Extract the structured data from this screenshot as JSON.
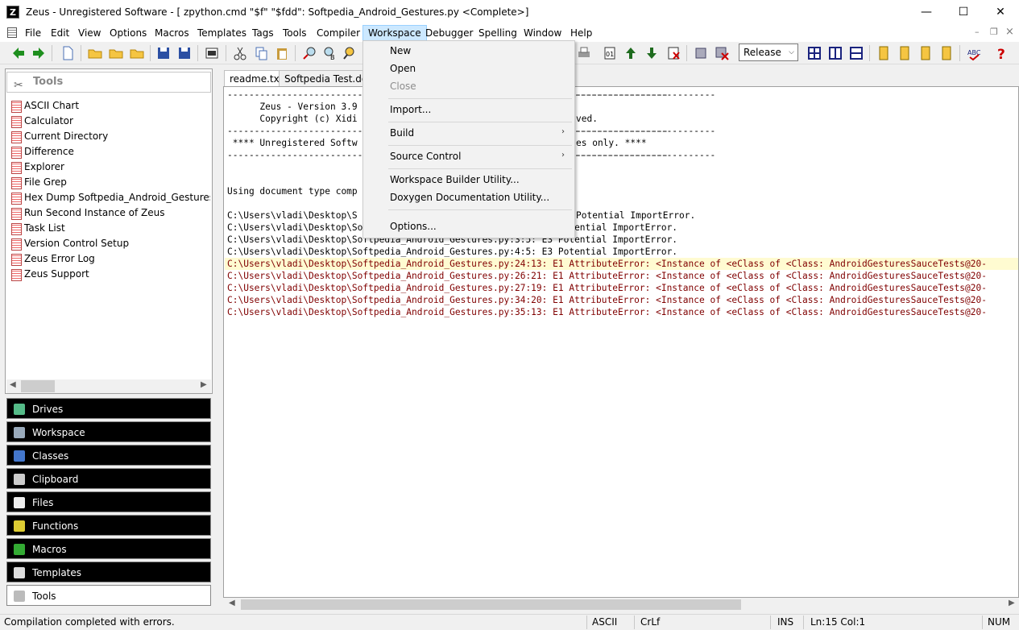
{
  "window": {
    "app_icon": "Z",
    "title": "Zeus - Unregistered Software - [ zpython.cmd \"$f\" \"$fdd\": Softpedia_Android_Gestures.py <Complete>]",
    "minimize": "—",
    "maximize": "☐",
    "close": "✕"
  },
  "menubar": {
    "items": [
      "File",
      "Edit",
      "View",
      "Options",
      "Macros",
      "Templates",
      "Tags",
      "Tools",
      "Compiler",
      "Workspace",
      "Debugger",
      "Spelling",
      "Window",
      "Help"
    ],
    "mdi_minimize": "–",
    "mdi_restore": "❐",
    "mdi_close": "×"
  },
  "toolbar": {
    "config_select": "Release",
    "config_arrow": "⌵"
  },
  "tools_panel": {
    "header": "Tools",
    "header_icon": "✂",
    "items": [
      "ASCII Chart",
      "Calculator",
      "Current Directory",
      "Difference",
      "Explorer",
      "File Grep",
      "Hex Dump  Softpedia_Android_Gestures.py...",
      "Run Second Instance of Zeus",
      "Task List",
      "Version Control Setup",
      "Zeus Error Log",
      "Zeus Support"
    ],
    "scroll_left": "◀",
    "scroll_right": "▶"
  },
  "panels": [
    "Drives",
    "Workspace",
    "Classes",
    "Clipboard",
    "Files",
    "Functions",
    "Macros",
    "Templates",
    "Tools"
  ],
  "tabs": [
    "readme.txt",
    "Softpedia Test.doc"
  ],
  "editor": {
    "lines": [
      "------------------------------------------------------------------------------------------",
      "      Zeus - Version 3.9",
      "      Copyright (c) Xidi",
      "------------------------------------------------------------------------------------------",
      " **** Unregistered Softw",
      "------------------------------------------------------------------------------------------",
      "",
      "",
      "Using document type comp",
      "",
      "C:\\Users\\vladi\\Desktop\\S",
      "C:\\Users\\vladi\\Desktop\\Softpedia_Android_Gestures.py:3:1: E3 Potential ImportError.",
      "C:\\Users\\vladi\\Desktop\\Softpedia_Android_Gestures.py:3:5: E3 Potential ImportError.",
      "C:\\Users\\vladi\\Desktop\\Softpedia_Android_Gestures.py:4:5: E3 Potential ImportError."
    ],
    "right_fragments": {
      "line0": "-----------------",
      "line2": "ved.",
      "line3": "-----------------",
      "line4": "es only. ****",
      "line5": "-----------------",
      "line10": "Potential ImportError."
    },
    "error_lines": [
      "C:\\Users\\vladi\\Desktop\\Softpedia_Android_Gestures.py:24:13: E1 AttributeError: <Instance of <eClass of <Class: AndroidGesturesSauceTests@20-",
      "C:\\Users\\vladi\\Desktop\\Softpedia_Android_Gestures.py:26:21: E1 AttributeError: <Instance of <eClass of <Class: AndroidGesturesSauceTests@20-",
      "C:\\Users\\vladi\\Desktop\\Softpedia_Android_Gestures.py:27:19: E1 AttributeError: <Instance of <eClass of <Class: AndroidGesturesSauceTests@20-",
      "C:\\Users\\vladi\\Desktop\\Softpedia_Android_Gestures.py:34:20: E1 AttributeError: <Instance of <eClass of <Class: AndroidGesturesSauceTests@20-",
      "C:\\Users\\vladi\\Desktop\\Softpedia_Android_Gestures.py:35:13: E1 AttributeError: <Instance of <eClass of <Class: AndroidGesturesSauceTests@20-"
    ],
    "scroll_left": "◀",
    "scroll_right": "▶"
  },
  "workspace_menu": {
    "items": {
      "new": "New",
      "open": "Open",
      "close": "Close",
      "import": "Import...",
      "build": "Build",
      "source_control": "Source Control",
      "builder": "Workspace Builder Utility...",
      "doxygen": "Doxygen Documentation Utility...",
      "options": "Options..."
    },
    "submenu_arrow": "›"
  },
  "statusbar": {
    "message": "Compilation completed with errors.",
    "encoding": "ASCII",
    "line_ending": "CrLf",
    "mode": "INS",
    "position": "Ln:15 Col:1",
    "numlock": "NUM"
  },
  "colors": {
    "menu_highlight": "#cce8ff",
    "error_text": "#800000",
    "error_highlight": "#fffbd1",
    "panel_button": "#000000"
  }
}
